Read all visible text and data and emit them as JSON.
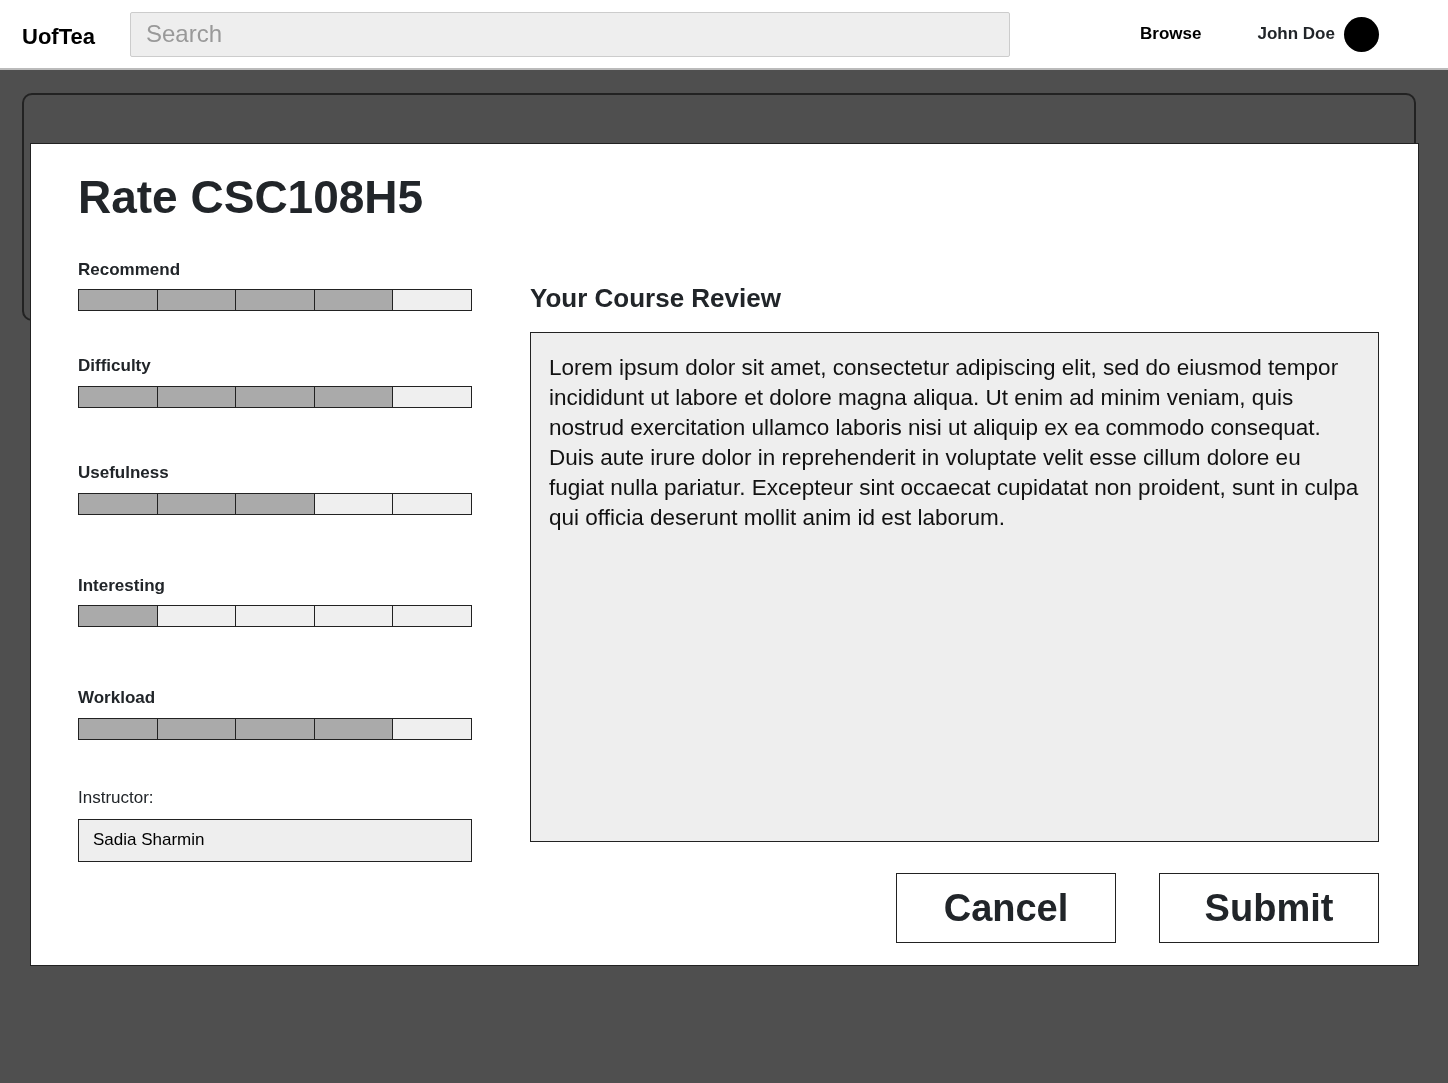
{
  "navbar": {
    "brand": "UofTea",
    "search": {
      "placeholder": "Search"
    },
    "links": [
      "Browse"
    ],
    "user": "John Doe"
  },
  "modal": {
    "title": "Rate CSC108H5",
    "ratings": [
      {
        "label": "Recommend",
        "level": 0.8
      },
      {
        "label": "Difficulty",
        "level": 0.8
      },
      {
        "label": "Usefulness",
        "level": 0.6
      },
      {
        "label": "Interesting",
        "level": 0.2
      },
      {
        "label": "Workload",
        "level": 0.8
      }
    ],
    "instructor": {
      "label": "Instructor:",
      "value": "Sadia Sharmin"
    },
    "review": {
      "heading": "Your Course Review",
      "value": "Lorem ipsum dolor sit amet, consectetur adipiscing elit, sed do eiusmod tempor incididunt ut labore et dolore magna aliqua. Ut enim ad minim veniam, quis nostrud exercitation ullamco laboris nisi ut aliquip ex ea commodo consequat. Duis aute irure dolor in reprehenderit in voluptate velit esse cillum dolore eu fugiat nulla pariatur. Excepteur sint occaecat cupidatat non proident, sunt in culpa qui officia deserunt mollit anim id est laborum."
    },
    "buttons": [
      "Cancel",
      "Submit"
    ]
  }
}
